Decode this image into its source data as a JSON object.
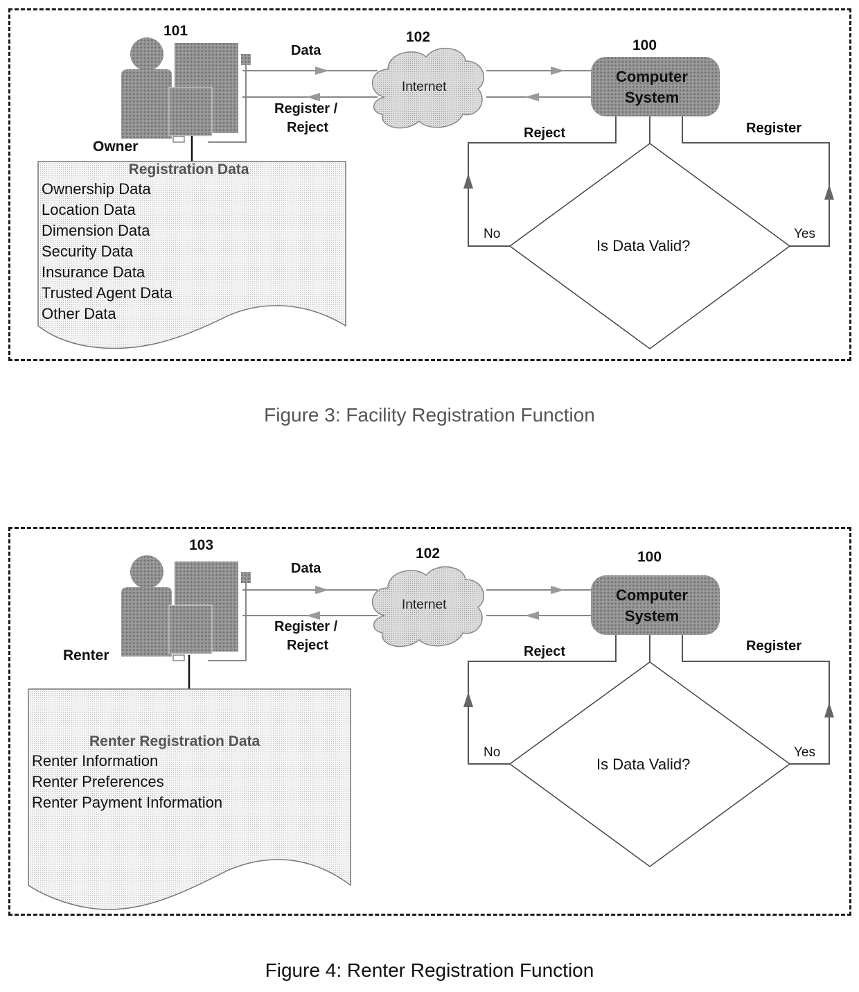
{
  "figures": [
    {
      "caption": "Figure 3: Facility Registration Function",
      "user_ref": "101",
      "user_label": "Owner",
      "data_arrow_label": "Data",
      "return_arrow_label_line1": "Register /",
      "return_arrow_label_line2": "Reject",
      "internet_ref": "102",
      "internet_label": "Internet",
      "system_ref": "100",
      "system_label_line1": "Computer",
      "system_label_line2": "System",
      "reject_label": "Reject",
      "register_label": "Register",
      "decision_label": "Is Data Valid?",
      "no_label": "No",
      "yes_label": "Yes",
      "document": {
        "title": "Registration Data",
        "items": [
          "Ownership Data",
          "Location Data",
          "Dimension Data",
          "Security Data",
          "Insurance Data",
          "Trusted Agent Data",
          "Other Data"
        ]
      }
    },
    {
      "caption": "Figure 4: Renter Registration Function",
      "user_ref": "103",
      "user_label": "Renter",
      "data_arrow_label": "Data",
      "return_arrow_label_line1": "Register /",
      "return_arrow_label_line2": "Reject",
      "internet_ref": "102",
      "internet_label": "Internet",
      "system_ref": "100",
      "system_label_line1": "Computer",
      "system_label_line2": "System",
      "reject_label": "Reject",
      "register_label": "Register",
      "decision_label": "Is Data Valid?",
      "no_label": "No",
      "yes_label": "Yes",
      "document": {
        "title": "Renter Registration Data",
        "items": [
          "Renter Information",
          "Renter Preferences",
          "Renter Payment Information"
        ]
      }
    }
  ],
  "colors": {
    "icon_fill": "#8a8a8a",
    "system_fill": "#9a9a9a",
    "document_fill": "#f0f0f0",
    "cloud_fill": "#d8d8d8",
    "line": "#555555"
  }
}
